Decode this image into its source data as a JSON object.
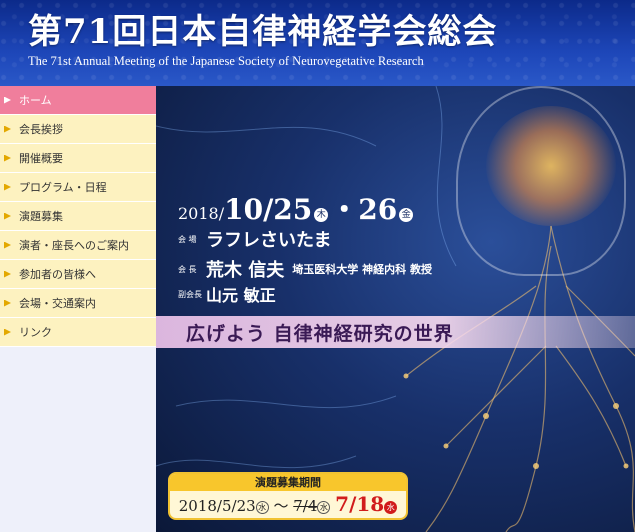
{
  "header": {
    "title": "第71回日本自律神経学会総会",
    "subtitle": "The 71st Annual Meeting of the Japanese Society of Neurovegetative Research"
  },
  "sidebar": {
    "items": [
      {
        "label": "ホーム",
        "active": true
      },
      {
        "label": "会長挨拶"
      },
      {
        "label": "開催概要"
      },
      {
        "label": "プログラム・日程"
      },
      {
        "label": "演題募集"
      },
      {
        "label": "演者・座長へのご案内"
      },
      {
        "label": "参加者の皆様へ"
      },
      {
        "label": "会場・交通案内"
      },
      {
        "label": "リンク"
      }
    ]
  },
  "hero": {
    "year": "2018/",
    "day1": "10/25",
    "day1_weekday": "木",
    "sep": "・",
    "day2": "26",
    "day2_weekday": "金",
    "venue_label": "会 場",
    "venue": "ラフレさいたま",
    "president_label": "会 長",
    "president": "荒木 信夫",
    "president_affiliation": "埼玉医科大学 神経内科 教授",
    "vice_label": "副会長",
    "vice_president": "山元 敏正",
    "tagline": "広げよう 自律神経研究の世界"
  },
  "deadline": {
    "title": "演題募集期間",
    "start": "2018/5/23",
    "start_weekday": "水",
    "tilde": "〜",
    "old_end": "7/4",
    "old_weekday": "水",
    "new_end": "7/18",
    "new_weekday": "水"
  },
  "colors": {
    "header_bg": "#1d46b8",
    "nav_bg": "#fdf2c0",
    "nav_active": "#f07e9c",
    "deadline_red": "#d11c1c"
  }
}
